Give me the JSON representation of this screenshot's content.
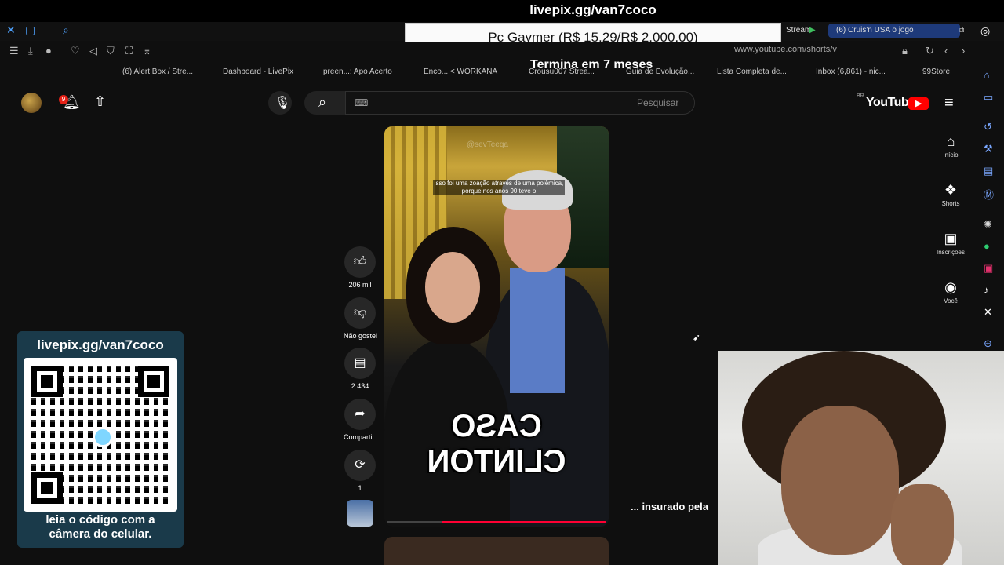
{
  "stream": {
    "url_overlay": "livepix.gg/van7coco",
    "goal_text": "Pc Gaymer (R$ 15,29/R$ 2.000,00)",
    "countdown": "Termina em 7 meses"
  },
  "browser": {
    "tabs": [
      {
        "label": "Stream"
      },
      {
        "label": "(6) Cruis'n USA o jogo"
      }
    ],
    "url": "www.youtube.com/shorts/v",
    "bookmarks": [
      {
        "label": "(6) Alert Box / Stre..."
      },
      {
        "label": "Dashboard - LivePix"
      },
      {
        "label": "preen...: Apo Acerto"
      },
      {
        "label": "Enco... < WORKANA"
      },
      {
        "label": "Crousu007 Strea..."
      },
      {
        "label": "Guia de Evolução..."
      },
      {
        "label": "Lista Completa de..."
      },
      {
        "label": "Inbox (6,861) - nic..."
      },
      {
        "label": "99Store"
      }
    ]
  },
  "youtube": {
    "logo_text": "YouTube",
    "region": "BR",
    "search_placeholder": "Pesquisar",
    "notification_count": "9",
    "nav": [
      {
        "label": "Início",
        "icon": "home-icon"
      },
      {
        "label": "Shorts",
        "icon": "shorts-icon"
      },
      {
        "label": "Inscrições",
        "icon": "subscriptions-icon"
      },
      {
        "label": "Você",
        "icon": "you-icon"
      }
    ]
  },
  "video": {
    "watermark": "@sevTeeqa",
    "caption_top": "isso foi uma zoação através de uma polêmica, porque nos anos 90 teve o",
    "caption_big": "CASO CLINTON",
    "progress_fraction": 0.75,
    "title_partial": "... insurado pela"
  },
  "actions": {
    "likes": "206 mil",
    "dislike": "Não gostei",
    "comments": "2.434",
    "share": "Compartil...",
    "remix": "1"
  },
  "qr": {
    "title": "livepix.gg/van7coco",
    "caption_line1": "leia o código com a",
    "caption_line2": "câmera do celular."
  }
}
